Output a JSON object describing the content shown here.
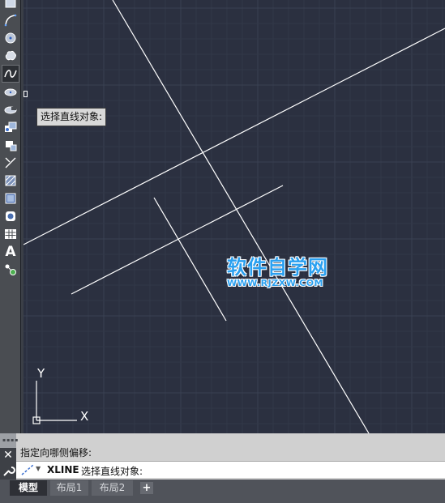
{
  "toolbar": {
    "tools": [
      {
        "icon": "rectangle-icon",
        "active": false
      },
      {
        "icon": "arc-icon",
        "active": false
      },
      {
        "icon": "circle-icon",
        "active": false
      },
      {
        "icon": "revision-cloud-icon",
        "active": false
      },
      {
        "icon": "spline-icon",
        "active": true
      },
      {
        "icon": "ellipse-icon",
        "active": false
      },
      {
        "icon": "ellipse-arc-icon",
        "active": false
      },
      {
        "icon": "insert-block-icon",
        "active": false
      },
      {
        "icon": "make-block-icon",
        "active": false
      },
      {
        "icon": "point-icon",
        "active": false
      },
      {
        "icon": "hatch-icon",
        "active": false
      },
      {
        "icon": "gradient-icon",
        "active": false
      },
      {
        "icon": "region-icon",
        "active": false
      },
      {
        "icon": "table-icon",
        "active": false
      },
      {
        "icon": "multiline-text-icon",
        "active": false,
        "glyph": "A"
      },
      {
        "icon": "add-selected-icon",
        "active": false
      }
    ]
  },
  "canvas": {
    "tooltip": "选择直线对象:",
    "ucs": {
      "x_label": "X",
      "y_label": "Y"
    },
    "colors": {
      "background": "#2b3040",
      "grid_minor": "#323848",
      "grid_major": "#3a4152",
      "geometry": "#ffffff"
    }
  },
  "watermark": {
    "title": "软件自学网",
    "url": "WWW.RJZXW.COM"
  },
  "command": {
    "history": "指定向哪侧偏移:",
    "keyword": "XLINE",
    "prompt": "选择直线对象:"
  },
  "tabs": {
    "items": [
      {
        "label": "模型",
        "active": true
      },
      {
        "label": "布局1",
        "active": false
      },
      {
        "label": "布局2",
        "active": false
      }
    ],
    "add_label": "+"
  }
}
